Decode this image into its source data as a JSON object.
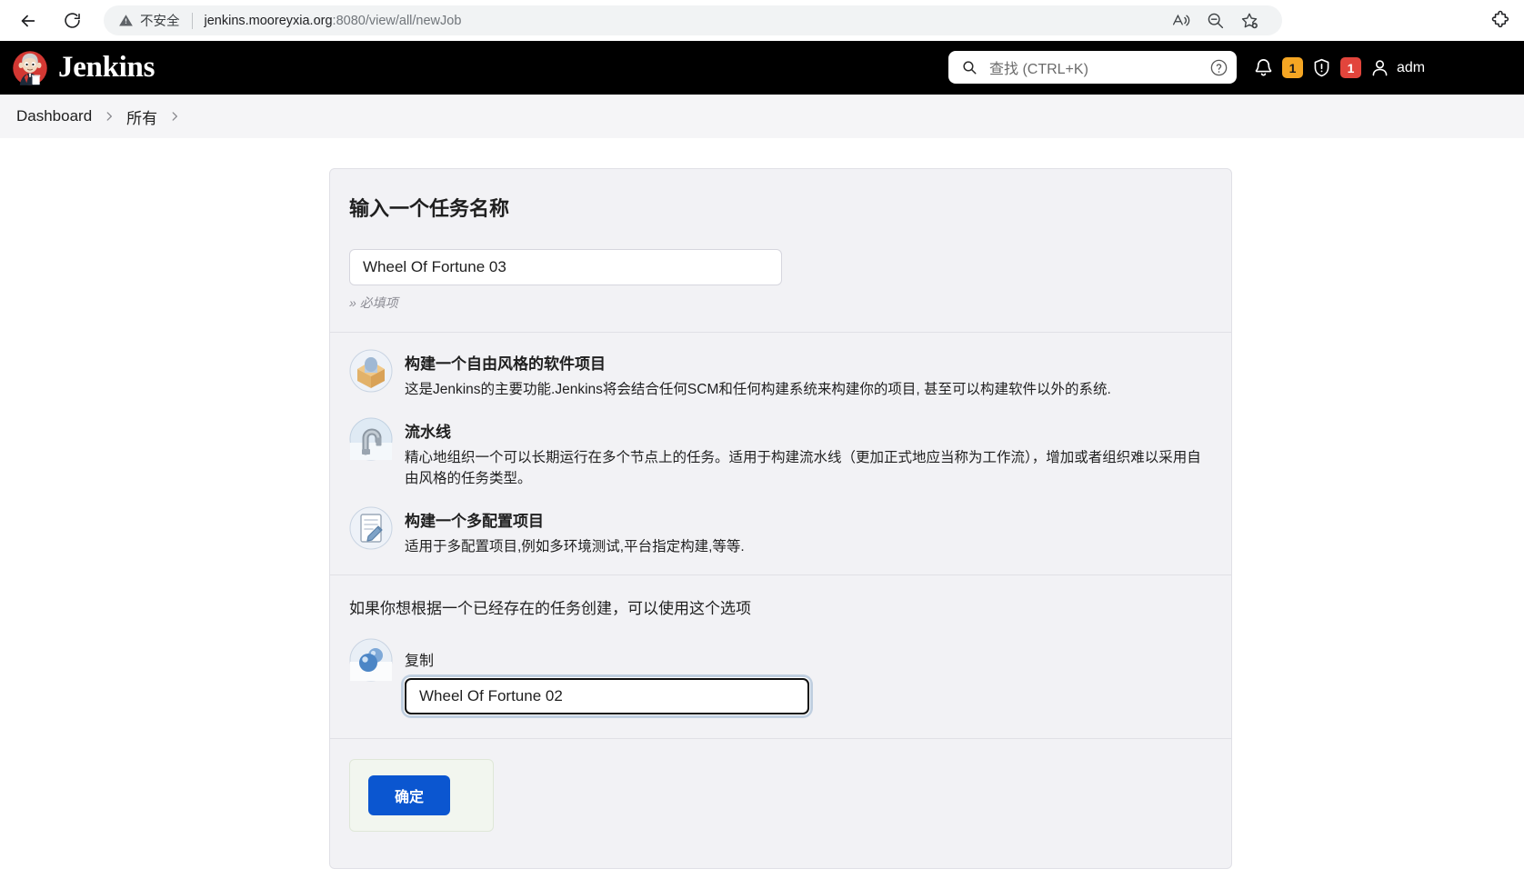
{
  "browser": {
    "back_label": "back-arrow",
    "reload_label": "reload",
    "security_text": "不安全",
    "url_host": "jenkins.mooreyxia.org",
    "url_rest": ":8080/view/all/newJob",
    "icons": [
      "read-aloud-icon",
      "zoom-out-icon",
      "favorites-add-icon",
      "extensions-icon"
    ]
  },
  "header": {
    "brand": "Jenkins",
    "search_placeholder": "查找 (CTRL+K)",
    "help_label": "?",
    "notification_count": "1",
    "security_count": "1",
    "user_name": "adm"
  },
  "breadcrumb": {
    "items": [
      {
        "label": "Dashboard"
      },
      {
        "label": "所有"
      }
    ]
  },
  "form": {
    "title": "输入一个任务名称",
    "name_value": "Wheel Of Fortune 03",
    "name_placeholder": "",
    "required_hint": "» 必填项",
    "job_types": [
      {
        "name": "构建一个自由风格的软件项目",
        "desc": "这是Jenkins的主要功能.Jenkins将会结合任何SCM和任何构建系统来构建你的项目, 甚至可以构建软件以外的系统.",
        "icon": "freestyle-project-icon"
      },
      {
        "name": "流水线",
        "desc": "精心地组织一个可以长期运行在多个节点上的任务。适用于构建流水线（更加正式地应当称为工作流），增加或者组织难以采用自由风格的任务类型。",
        "icon": "pipeline-icon"
      },
      {
        "name": "构建一个多配置项目",
        "desc": "适用于多配置项目,例如多环境测试,平台指定构建,等等.",
        "icon": "multiconfiguration-project-icon"
      }
    ],
    "copy": {
      "lead": "如果你想根据一个已经存在的任务创建，可以使用这个选项",
      "label": "复制",
      "value": "Wheel Of Fortune 02",
      "placeholder": ""
    },
    "submit_label": "确定"
  },
  "colors": {
    "accent_blue": "#0b56d0",
    "badge_orange": "#f5a623",
    "badge_red": "#e2453c",
    "header_black": "#000000",
    "card_bg": "#f2f2f5"
  }
}
